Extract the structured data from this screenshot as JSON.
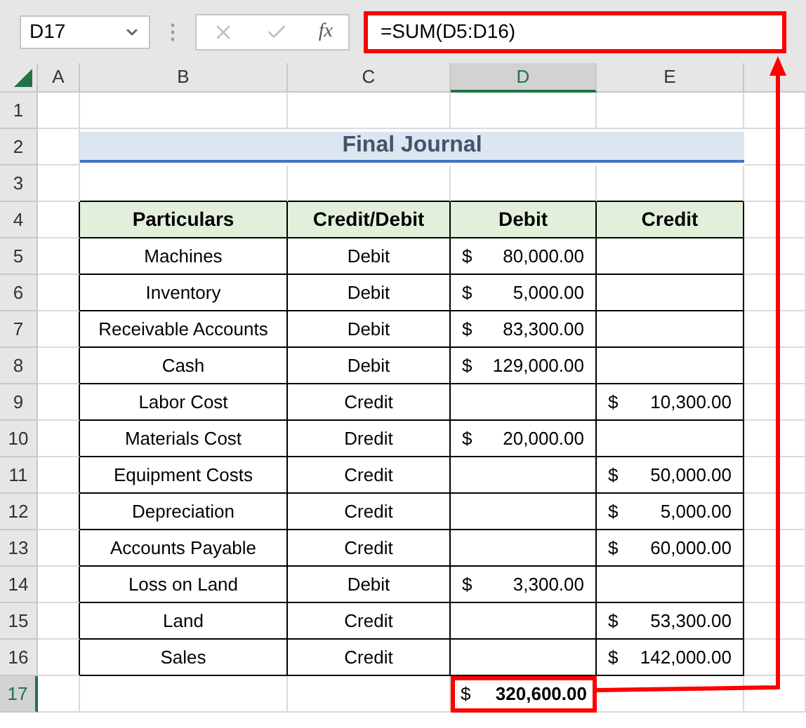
{
  "name_box": {
    "value": "D17"
  },
  "formula_bar": {
    "cancel_disabled": true,
    "enter_disabled": true,
    "function_label": "fx",
    "formula": "=SUM(D5:D16)",
    "highlighted": true
  },
  "columns": [
    {
      "label": "A",
      "selected": false
    },
    {
      "label": "B",
      "selected": false
    },
    {
      "label": "C",
      "selected": false
    },
    {
      "label": "D",
      "selected": true
    },
    {
      "label": "E",
      "selected": false
    }
  ],
  "row_numbers": [
    {
      "label": "1",
      "selected": false
    },
    {
      "label": "2",
      "selected": false
    },
    {
      "label": "3",
      "selected": false
    },
    {
      "label": "4",
      "selected": false
    },
    {
      "label": "5",
      "selected": false
    },
    {
      "label": "6",
      "selected": false
    },
    {
      "label": "7",
      "selected": false
    },
    {
      "label": "8",
      "selected": false
    },
    {
      "label": "9",
      "selected": false
    },
    {
      "label": "10",
      "selected": false
    },
    {
      "label": "11",
      "selected": false
    },
    {
      "label": "12",
      "selected": false
    },
    {
      "label": "13",
      "selected": false
    },
    {
      "label": "14",
      "selected": false
    },
    {
      "label": "15",
      "selected": false
    },
    {
      "label": "16",
      "selected": false
    },
    {
      "label": "17",
      "selected": true
    }
  ],
  "title": "Final Journal",
  "table": {
    "columns": [
      "Particulars",
      "Credit/Debit",
      "Debit",
      "Credit"
    ],
    "rows": [
      {
        "particulars": "Machines",
        "type": "Debit",
        "debit": {
          "symbol": "$",
          "amount": "80,000.00"
        },
        "credit": null
      },
      {
        "particulars": "Inventory",
        "type": "Debit",
        "debit": {
          "symbol": "$",
          "amount": "5,000.00"
        },
        "credit": null
      },
      {
        "particulars": "Receivable Accounts",
        "type": "Debit",
        "debit": {
          "symbol": "$",
          "amount": "83,300.00"
        },
        "credit": null
      },
      {
        "particulars": "Cash",
        "type": "Debit",
        "debit": {
          "symbol": "$",
          "amount": "129,000.00"
        },
        "credit": null
      },
      {
        "particulars": "Labor Cost",
        "type": "Credit",
        "debit": null,
        "credit": {
          "symbol": "$",
          "amount": "10,300.00"
        }
      },
      {
        "particulars": "Materials Cost",
        "type": "Dredit",
        "debit": {
          "symbol": "$",
          "amount": "20,000.00"
        },
        "credit": null
      },
      {
        "particulars": "Equipment Costs",
        "type": "Credit",
        "debit": null,
        "credit": {
          "symbol": "$",
          "amount": "50,000.00"
        }
      },
      {
        "particulars": "Depreciation",
        "type": "Credit",
        "debit": null,
        "credit": {
          "symbol": "$",
          "amount": "5,000.00"
        }
      },
      {
        "particulars": "Accounts Payable",
        "type": "Credit",
        "debit": null,
        "credit": {
          "symbol": "$",
          "amount": "60,000.00"
        }
      },
      {
        "particulars": "Loss on Land",
        "type": "Debit",
        "debit": {
          "symbol": "$",
          "amount": "3,300.00"
        },
        "credit": null
      },
      {
        "particulars": "Land",
        "type": "Credit",
        "debit": null,
        "credit": {
          "symbol": "$",
          "amount": "53,300.00"
        }
      },
      {
        "particulars": "Sales",
        "type": "Credit",
        "debit": null,
        "credit": {
          "symbol": "$",
          "amount": "142,000.00"
        }
      }
    ]
  },
  "total": {
    "symbol": "$",
    "amount": "320,600.00",
    "highlighted": true
  }
}
